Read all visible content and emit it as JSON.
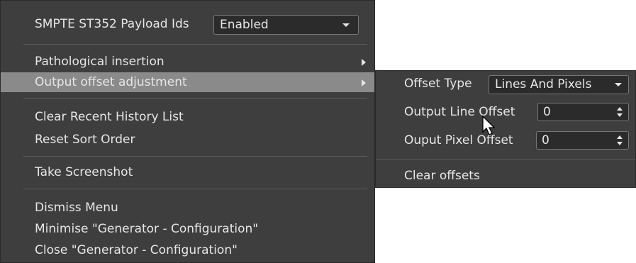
{
  "main_menu": {
    "payload_label": "SMPTE ST352 Payload Ids",
    "payload_value": "Enabled",
    "items": [
      {
        "label": "Pathological insertion"
      },
      {
        "label": "Output offset adjustment"
      },
      {
        "label": "Clear Recent History List"
      },
      {
        "label": "Reset Sort Order"
      },
      {
        "label": "Take Screenshot"
      },
      {
        "label": "Dismiss Menu"
      },
      {
        "label": "Minimise \"Generator - Configuration\""
      },
      {
        "label": "Close \"Generator - Configuration\""
      }
    ]
  },
  "submenu": {
    "offset_type_label": "Offset Type",
    "offset_type_value": "Lines And Pixels",
    "line_offset_label": "Output Line Offset",
    "line_offset_value": "0",
    "pixel_offset_label": "Ouput Pixel Offset",
    "pixel_offset_value": "0",
    "clear_label": "Clear offsets"
  },
  "colors": {
    "menu_bg": "#3e3e3e",
    "highlight": "#8a8a8a",
    "text": "#e6e6e6"
  }
}
